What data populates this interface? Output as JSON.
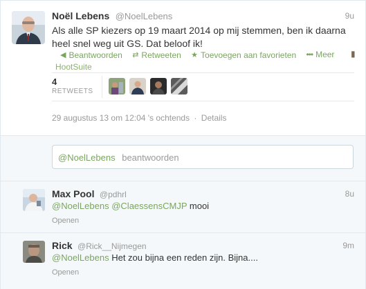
{
  "main_tweet": {
    "fullname": "Noël Lebens",
    "screen_name": "@NoelLebens",
    "time": "9u",
    "text": "Als alle SP kiezers op 19 maart 2014 op mij stemmen, ben ik daarna heel snel weg uit GS. Dat beloof ik!",
    "actions": {
      "reply": "Beantwoorden",
      "retweet": "Retweeten",
      "favorite": "Toevoegen aan favorieten",
      "more": "Meer"
    },
    "via": "HootSuite",
    "retweet_count": "4",
    "retweet_label": "RETWEETS",
    "timestamp": "29 augustus 13 om 12:04 's ochtends",
    "timestamp_sep": "·",
    "details_link": "Details"
  },
  "reply_box": {
    "mention": "@NoelLebens",
    "placeholder": "beantwoorden"
  },
  "replies": [
    {
      "fullname": "Max Pool",
      "screen_name": "@pdhrl",
      "time": "8u",
      "mention1": "@NoelLebens",
      "mention2": "@ClaessensCMJP",
      "text": "mooi",
      "open": "Openen"
    },
    {
      "fullname": "Rick",
      "screen_name": "@Rick__Nijmegen",
      "time": "9m",
      "mention1": "@NoelLebens",
      "text": "Het zou bijna een reden zijn. Bijna....",
      "open": "Openen"
    }
  ],
  "icons": {
    "reply": "reply-arrow-icon",
    "retweet": "retweet-icon",
    "favorite": "star-icon",
    "more": "more-dots-icon",
    "pin": "pin-icon"
  },
  "colors": {
    "accent": "#7aa55f",
    "muted": "#999999",
    "text": "#333333",
    "reply_bg": "#f5f8fa"
  }
}
